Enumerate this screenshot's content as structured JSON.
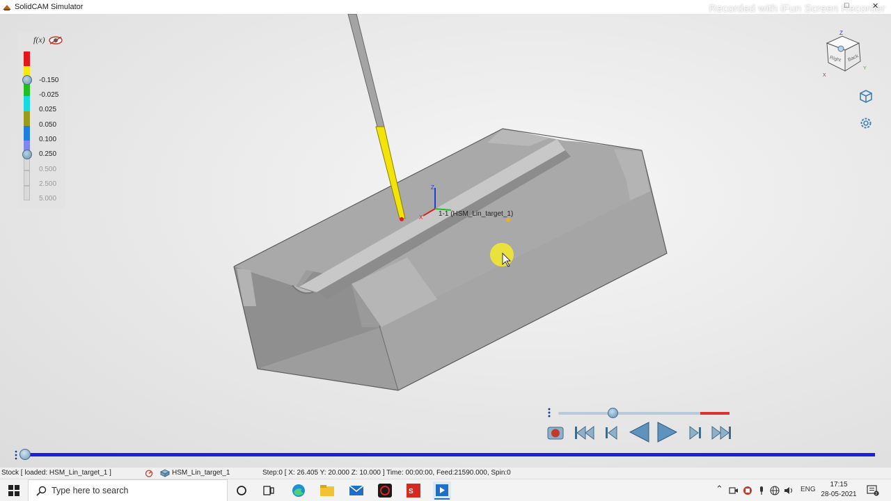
{
  "window": {
    "title": "SolidCAM Simulator",
    "watermark": "Recorded with iFun Screen Recorder"
  },
  "legend": {
    "fx_label": "f(x)",
    "values": [
      "-0.150",
      "-0.025",
      "0.025",
      "0.050",
      "0.100",
      "0.250",
      "0.500",
      "2.500",
      "5.000"
    ],
    "colors": [
      "#e8161c",
      "#f3e90a",
      "#1fbf1f",
      "#19d9e0",
      "#9c9a1c",
      "#1f7fe0",
      "#7f86ee",
      "#d9d9d9",
      "#d9d9d9",
      "#d9d9d9"
    ]
  },
  "scene": {
    "tool_label": "1-1 (HSM_Lin_target_1)",
    "axis_x": "X",
    "axis_z": "Z"
  },
  "viewcube": {
    "top": "Z",
    "face_right": "Right",
    "face_back": "Back",
    "axis_x": "X",
    "axis_y": "Y"
  },
  "playback": {
    "speed_fraction": 0.32,
    "progress_fraction": 0.0
  },
  "status": {
    "stock": "Stock [ loaded:  HSM_Lin_target_1 ]",
    "operation": "HSM_Lin_target_1",
    "step": "Step:0 [ X: 26.405 Y: 20.000 Z: 10.000 ] Time: 00:00:00, Feed:21590.000, Spin:0"
  },
  "taskbar": {
    "search_placeholder": "Type here to search",
    "language": "ENG",
    "time": "17:15",
    "date": "28-05-2021",
    "notification_count": "3"
  }
}
